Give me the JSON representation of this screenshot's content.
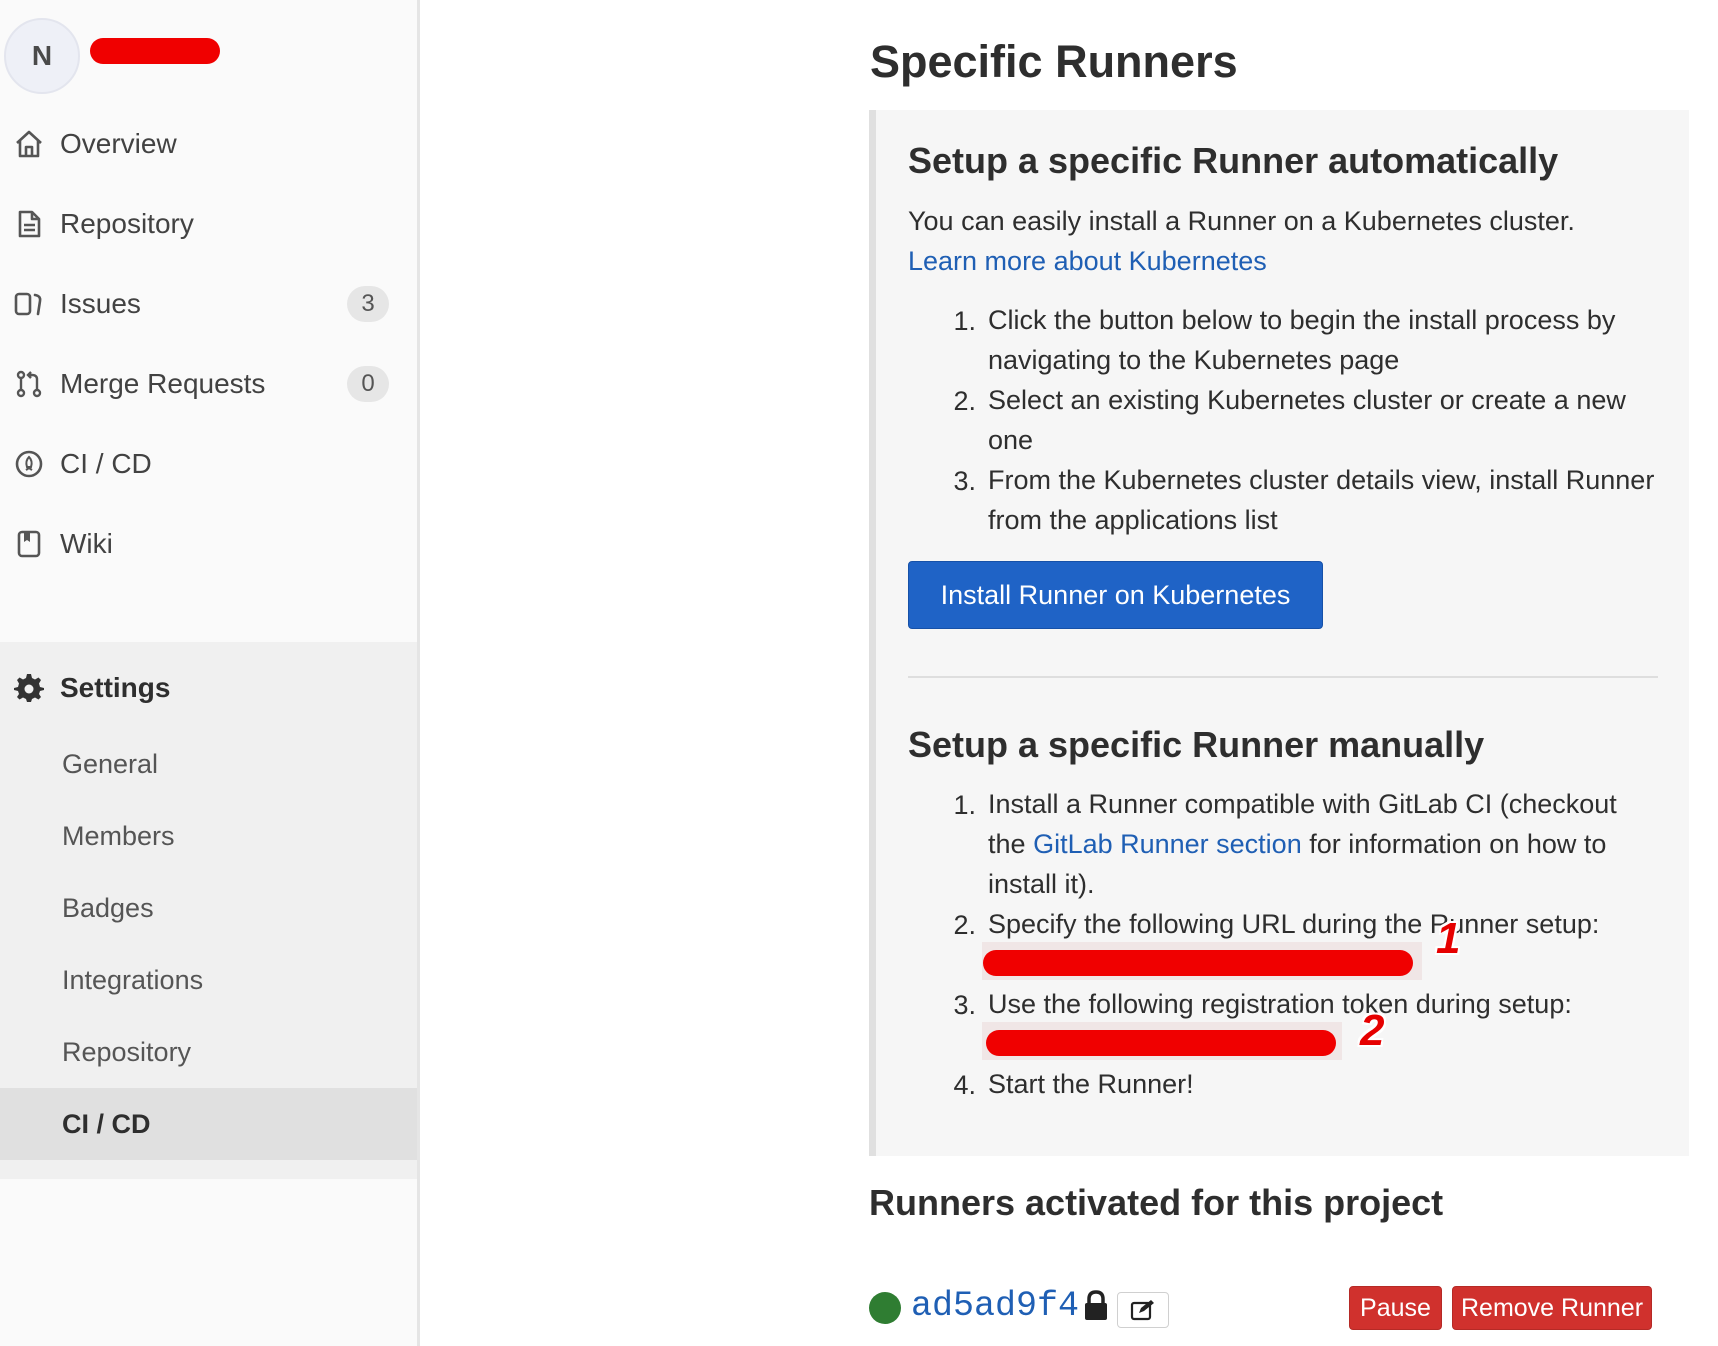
{
  "sidebar": {
    "avatar_letter": "N",
    "items": [
      {
        "label": "Overview",
        "icon": "home-icon"
      },
      {
        "label": "Repository",
        "icon": "document-icon"
      },
      {
        "label": "Issues",
        "icon": "issues-icon",
        "count": "3"
      },
      {
        "label": "Merge Requests",
        "icon": "merge-request-icon",
        "count": "0"
      },
      {
        "label": "CI / CD",
        "icon": "rocket-icon"
      },
      {
        "label": "Wiki",
        "icon": "book-icon"
      }
    ],
    "settings": {
      "label": "Settings",
      "icon": "gear-icon",
      "subitems": [
        "General",
        "Members",
        "Badges",
        "Integrations",
        "Repository",
        "CI / CD"
      ],
      "active": "CI / CD"
    }
  },
  "main": {
    "title": "Specific Runners",
    "auto": {
      "heading": "Setup a specific Runner automatically",
      "intro": "You can easily install a Runner on a Kubernetes cluster.",
      "learn_more": "Learn more about Kubernetes",
      "steps": [
        "Click the button below to begin the install process by navigating to the Kubernetes page",
        "Select an existing Kubernetes cluster or create a new one",
        "From the Kubernetes cluster details view, install Runner from the applications list"
      ],
      "button": "Install Runner on Kubernetes"
    },
    "manual": {
      "heading": "Setup a specific Runner manually",
      "step1_before": "Install a Runner compatible with GitLab CI (checkout the",
      "step1_link": "GitLab Runner section",
      "step1_after": "for information on how to install it).",
      "step2": "Specify the following URL during the Runner setup:",
      "step3": "Use the following registration token during setup:",
      "step4": "Start the Runner!",
      "marker1": "1",
      "marker2": "2"
    },
    "activated": {
      "heading": "Runners activated for this project",
      "runner_id": "ad5ad9f4",
      "status_color": "#2f7d32",
      "pause_label": "Pause",
      "remove_label": "Remove Runner"
    }
  },
  "colors": {
    "primary": "#1f63c6",
    "danger": "#d0312d",
    "link": "#1f5fb4",
    "redaction": "#f00000"
  }
}
